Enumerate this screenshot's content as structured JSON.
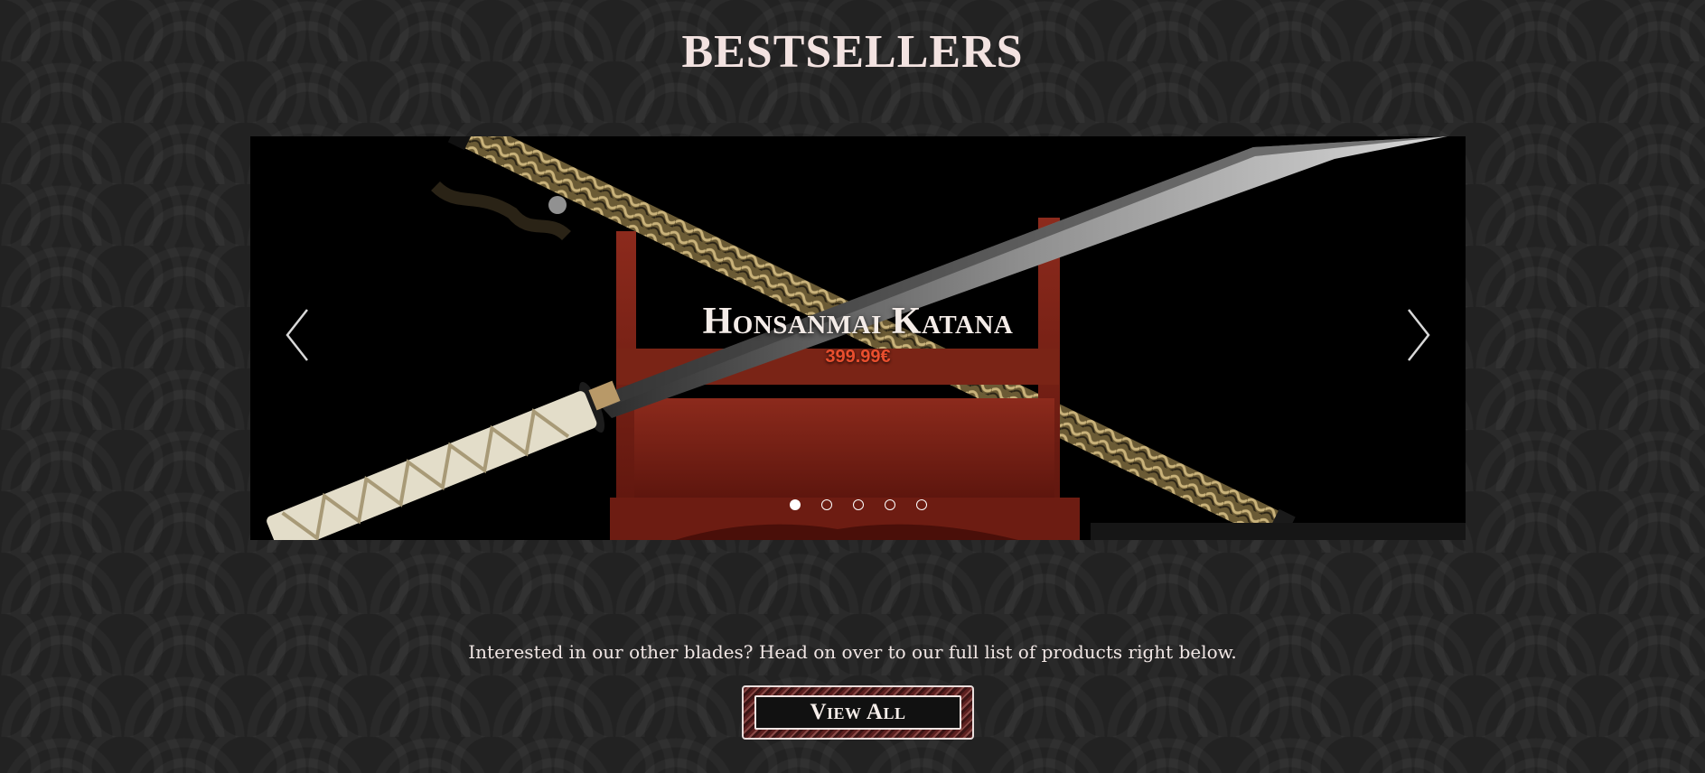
{
  "section": {
    "title": "BESTSELLERS"
  },
  "slider": {
    "product_name": "Honsanmai Katana",
    "price": "399.99€",
    "slide_count": 5,
    "active_slide": 1,
    "prev_icon": "chevron-left-icon",
    "next_icon": "chevron-right-icon",
    "background_color": "#000000",
    "price_color": "#e94f2e"
  },
  "footer": {
    "blurb": "Interested in our other blades? Head on over to our full list of products right below.",
    "view_all_label": "View All"
  }
}
